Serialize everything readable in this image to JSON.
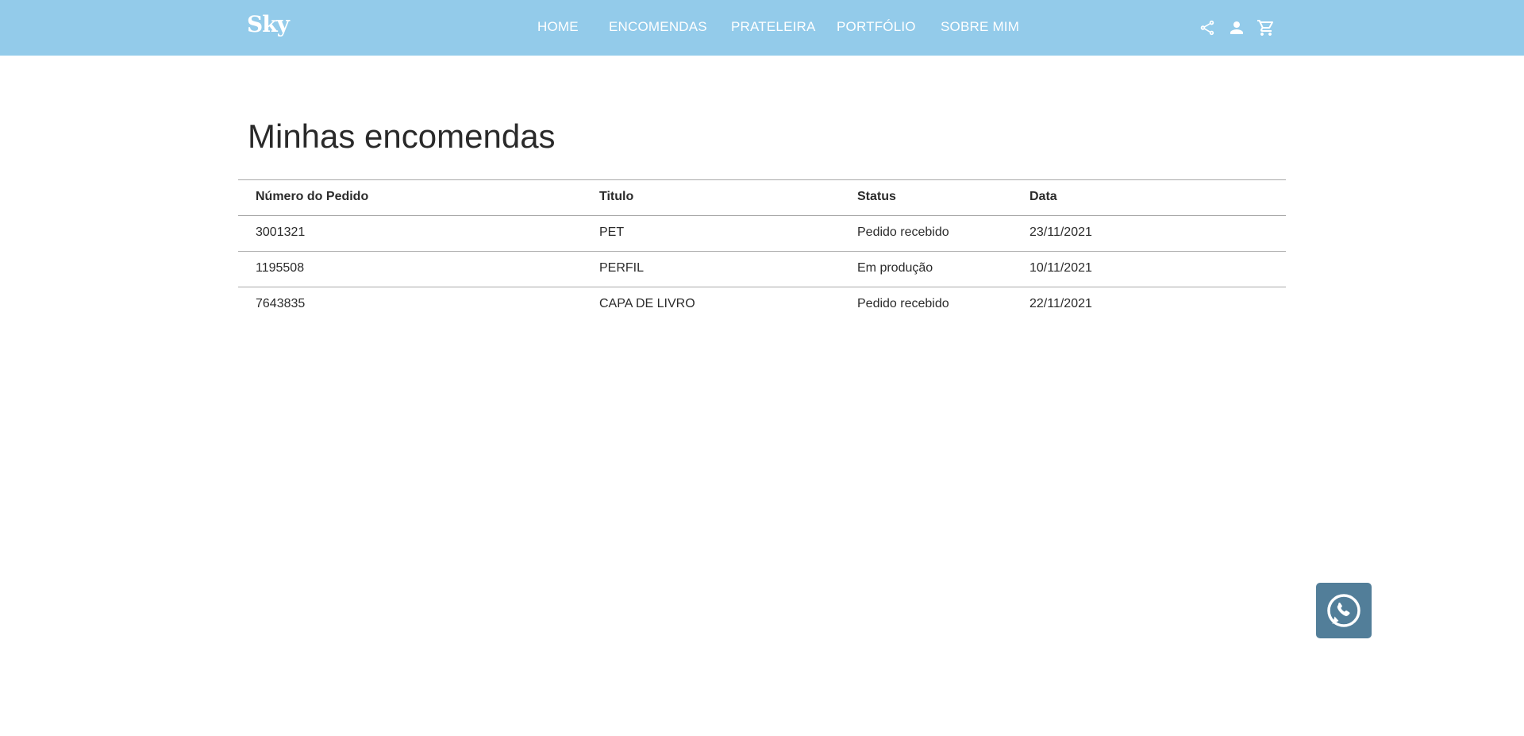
{
  "header": {
    "logo": "Sky",
    "nav": [
      "HOME",
      "ENCOMENDAS",
      "PRATELEIRA",
      "PORTFÓLIO",
      "SOBRE MIM"
    ],
    "icons": [
      "share-icon",
      "person-icon",
      "cart-icon"
    ],
    "background_color": "#93cbea"
  },
  "main": {
    "title": "Minhas encomendas",
    "table": {
      "columns": [
        "Número do Pedido",
        "Titulo",
        "Status",
        "Data"
      ],
      "rows": [
        [
          "3001321",
          "PET",
          "Pedido recebido",
          "23/11/2021"
        ],
        [
          "1195508",
          "PERFIL",
          "Em produção",
          "10/11/2021"
        ],
        [
          "7643835",
          "CAPA DE LIVRO",
          "Pedido recebido",
          "22/11/2021"
        ]
      ]
    }
  },
  "floating": {
    "icon": "whatsapp-icon",
    "background_color": "#527e99"
  }
}
